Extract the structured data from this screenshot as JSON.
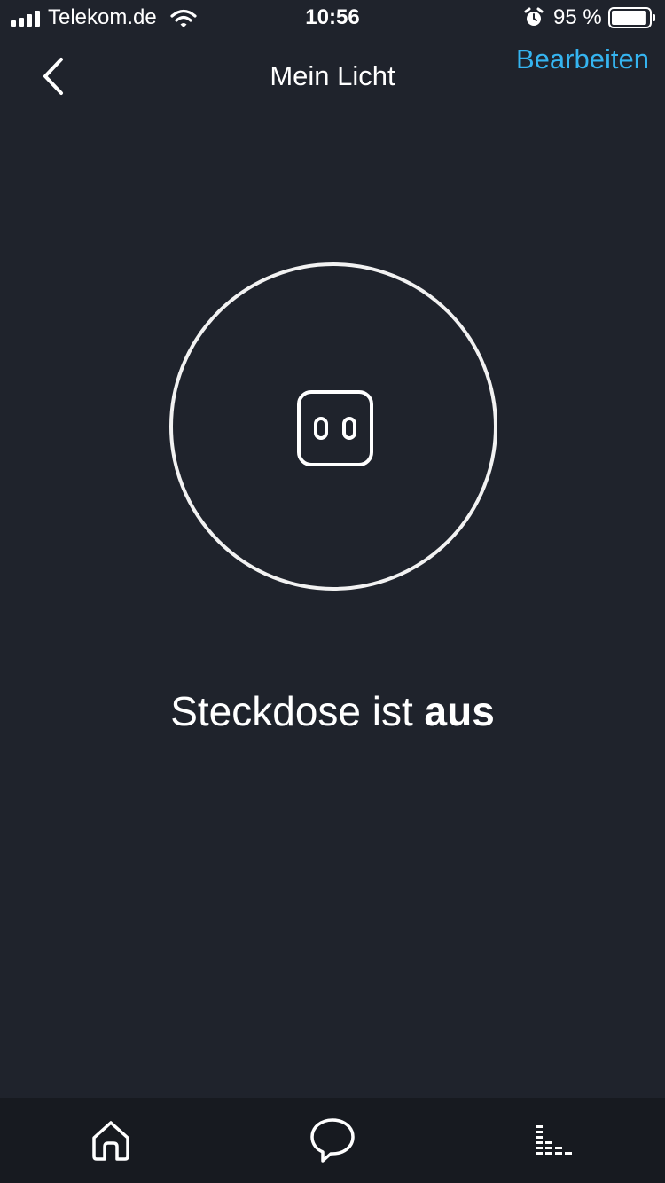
{
  "status_bar": {
    "carrier": "Telekom.de",
    "time": "10:56",
    "battery_percent": "95 %",
    "battery_level": 0.95,
    "icons": [
      "signal-icon",
      "wifi-icon",
      "alarm-icon",
      "battery-icon"
    ]
  },
  "header": {
    "title": "Mein Licht",
    "back_icon": "chevron-left-icon",
    "edit_label": "Bearbeiten"
  },
  "device": {
    "icon": "power-socket-icon",
    "status_prefix": "Steckdose ist ",
    "status_value": "aus"
  },
  "tab_bar": {
    "tabs": [
      {
        "icon": "home-icon"
      },
      {
        "icon": "chat-bubble-icon"
      },
      {
        "icon": "devices-icon"
      }
    ]
  },
  "colors": {
    "background": "#1f232c",
    "tab_bar": "#171a20",
    "accent": "#35b4f0",
    "foreground": "#ffffff"
  }
}
